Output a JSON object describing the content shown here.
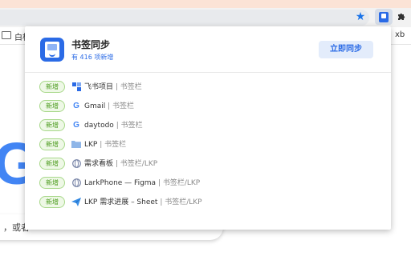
{
  "browser": {
    "bookmark_bar_item": "白板",
    "bookmark_bar_right": "xb",
    "search_hint": "，或者"
  },
  "popup": {
    "title": "书签同步",
    "subtitle": "有 416 项新增",
    "sync_button": "立即同步",
    "items": [
      {
        "badge": "新增",
        "name": "飞书项目",
        "path": "| 书签栏",
        "icon": "feishu-project-icon"
      },
      {
        "badge": "新增",
        "name": "Gmail",
        "path": "| 书签栏",
        "icon": "google-icon"
      },
      {
        "badge": "新增",
        "name": "daytodo",
        "path": "| 书签栏",
        "icon": "google-icon"
      },
      {
        "badge": "新增",
        "name": "LKP",
        "path": "| 书签栏",
        "icon": "folder-icon"
      },
      {
        "badge": "新增",
        "name": "需求看板",
        "path": "| 书签栏/LKP",
        "icon": "globe-icon"
      },
      {
        "badge": "新增",
        "name": "LarkPhone — Figma",
        "path": "| 书签栏/LKP",
        "icon": "globe-icon"
      },
      {
        "badge": "新增",
        "name": "LKP 需求进展 – Sheet",
        "path": "| 书签栏/LKP",
        "icon": "lark-icon"
      }
    ]
  },
  "colors": {
    "accent": "#2b6be6",
    "badge_green": "#4a9a1c"
  }
}
